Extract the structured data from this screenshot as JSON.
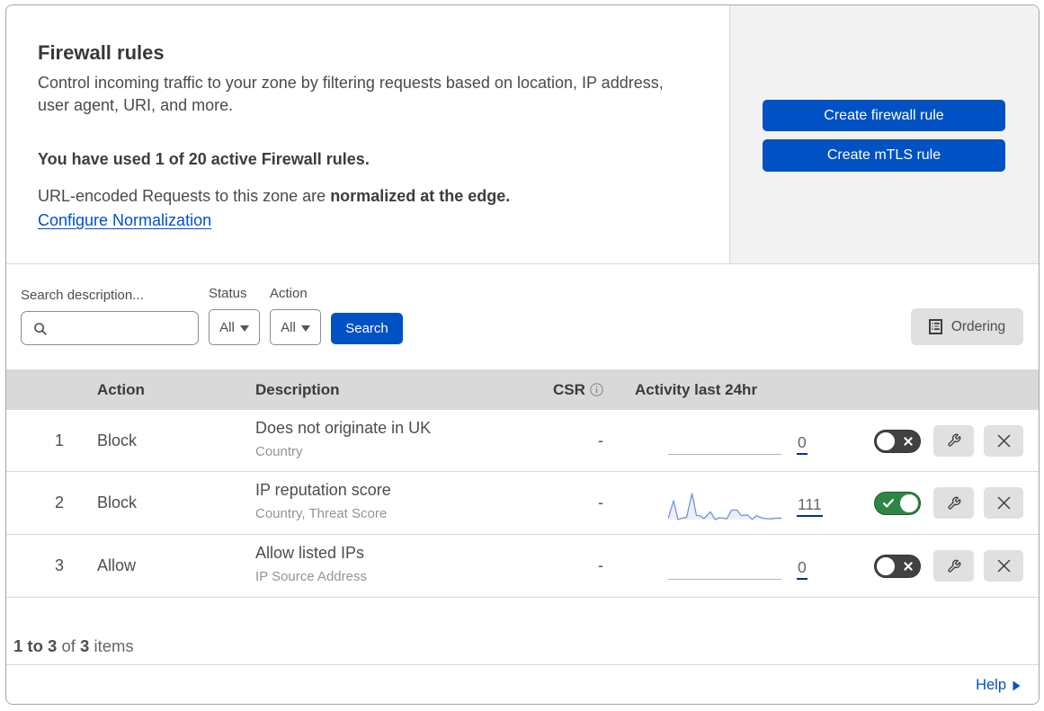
{
  "header": {
    "title": "Firewall rules",
    "description": "Control incoming traffic to your zone by filtering requests based on location, IP address, user agent, URI, and more.",
    "usage": "You have used 1 of 20 active Firewall rules.",
    "normalization_prefix": "URL-encoded Requests to this zone are ",
    "normalization_bold": "normalized at the edge.",
    "normalization_link": "Configure Normalization",
    "create_firewall_button": "Create firewall rule",
    "create_mtls_button": "Create mTLS rule"
  },
  "filters": {
    "search_label": "Search description...",
    "search_placeholder": "",
    "search_value": "",
    "status_label": "Status",
    "status_value": "All",
    "action_label": "Action",
    "action_value": "All",
    "search_button": "Search",
    "ordering_button": "Ordering"
  },
  "table": {
    "headers": {
      "action": "Action",
      "description": "Description",
      "csr": "CSR",
      "activity": "Activity last 24hr"
    },
    "rows": [
      {
        "num": "1",
        "action": "Block",
        "description": "Does not originate in UK",
        "criteria": "Country",
        "csr": "-",
        "activity_count": "0",
        "enabled": false
      },
      {
        "num": "2",
        "action": "Block",
        "description": "IP reputation score",
        "criteria": "Country, Threat Score",
        "csr": "-",
        "activity_count": "111",
        "enabled": true,
        "sparkline": [
          [
            0,
            1
          ],
          [
            6,
            21
          ],
          [
            11,
            0
          ],
          [
            15,
            1.5
          ],
          [
            20.5,
            2.5
          ],
          [
            26.6,
            29
          ],
          [
            31.5,
            4.5
          ],
          [
            35.6,
            4.2
          ],
          [
            39.8,
            1
          ],
          [
            47,
            8.7
          ],
          [
            52.5,
            0
          ],
          [
            56.7,
            2
          ],
          [
            60.9,
            1.7
          ],
          [
            65.2,
            0.8
          ],
          [
            70.6,
            10.5
          ],
          [
            76.6,
            10.5
          ],
          [
            81.4,
            4.4
          ],
          [
            85,
            5
          ],
          [
            88.7,
            4.8
          ],
          [
            93.5,
            0.2
          ],
          [
            98.3,
            4.4
          ],
          [
            101.9,
            2.6
          ],
          [
            106.2,
            1.4
          ],
          [
            110.4,
            1
          ],
          [
            114.6,
            0.8
          ],
          [
            118.8,
            1.4
          ],
          [
            123,
            1.7
          ],
          [
            126,
            1.5
          ]
        ]
      },
      {
        "num": "3",
        "action": "Allow",
        "description": "Allow listed IPs",
        "criteria": "IP Source Address",
        "csr": "-",
        "activity_count": "0",
        "enabled": false
      }
    ]
  },
  "pagination": {
    "range": "1 to 3",
    "of": "of",
    "total": "3",
    "items": "items"
  },
  "footer": {
    "help": "Help"
  },
  "colors": {
    "accent_blue": "#0051c3",
    "toggle_on_green": "#2e8644",
    "toggle_off_gray": "#3f4142",
    "table_header_bg": "#d9d9d9",
    "aside_bg": "#f2f2f2",
    "count_underline": "#003681",
    "sparkline_stroke": "#6d96db"
  }
}
